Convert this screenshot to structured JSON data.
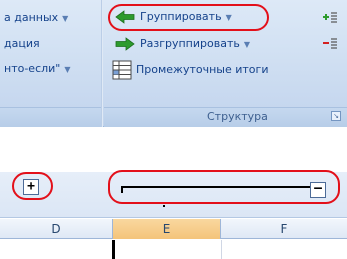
{
  "ribbon": {
    "left_items": [
      {
        "label": "а данных",
        "has_arrow": true
      },
      {
        "label": "дация",
        "has_arrow": false
      },
      {
        "label": "нто-если\"",
        "has_arrow": true
      }
    ],
    "group": {
      "label": "Группировать",
      "icon": "group-arrow-icon"
    },
    "ungroup": {
      "label": "Разгруппировать",
      "icon": "ungroup-arrow-icon"
    },
    "subtotal": {
      "label": "Промежуточные итоги",
      "icon": "subtotal-table-icon"
    },
    "show_detail_icon": "show-detail-icon",
    "hide_detail_icon": "hide-detail-icon",
    "group_name": "Структура",
    "dropdown_glyph": "▼",
    "launcher_glyph": "↘"
  },
  "outline": {
    "expand_symbol": "+",
    "collapse_symbol": "–"
  },
  "sheet": {
    "columns": [
      "D",
      "E",
      "F"
    ],
    "selected_column": "E"
  },
  "colors": {
    "highlight": "#e3101a",
    "group_arrow": "#2d9b2d",
    "selected_header": "#f4c47a"
  }
}
